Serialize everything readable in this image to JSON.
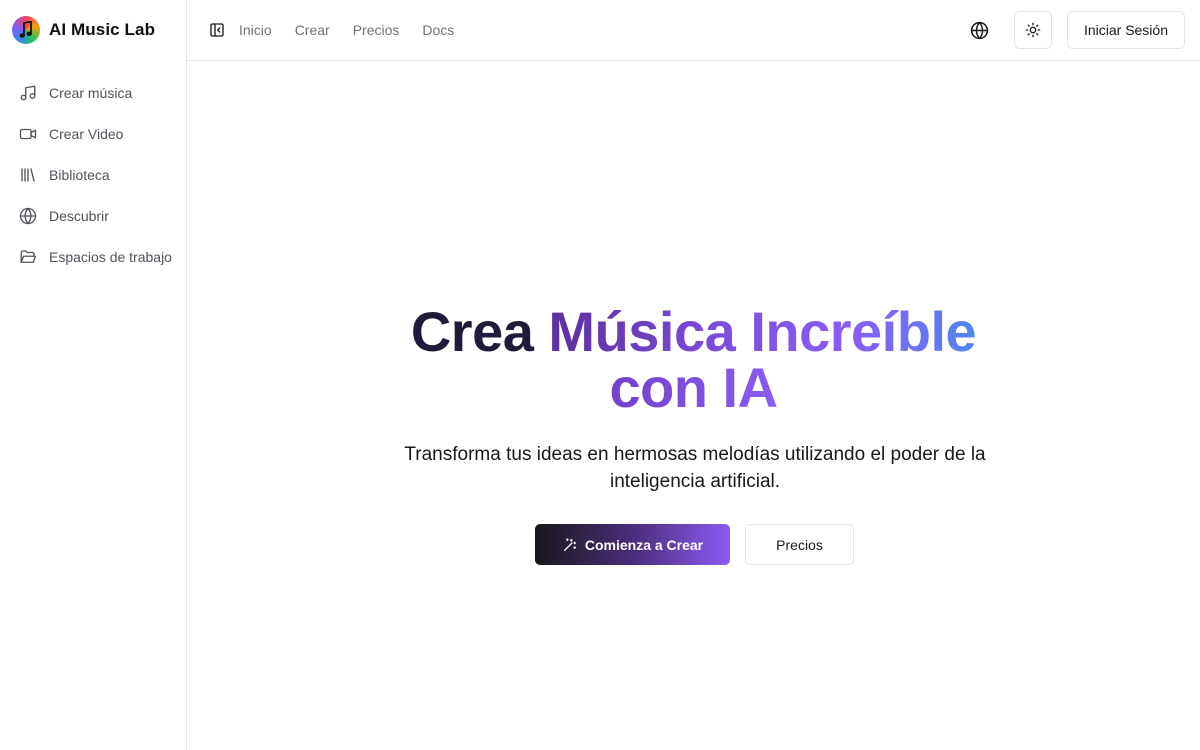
{
  "brand": {
    "name": "AI Music Lab",
    "logo_icon": "music-note-logo-icon"
  },
  "sidebar": {
    "items": [
      {
        "label": "Crear música",
        "icon": "music-note-icon"
      },
      {
        "label": "Crear Video",
        "icon": "video-camera-icon"
      },
      {
        "label": "Biblioteca",
        "icon": "library-icon"
      },
      {
        "label": "Descubrir",
        "icon": "globe-icon"
      },
      {
        "label": "Espacios de trabajo",
        "icon": "folder-open-icon"
      }
    ]
  },
  "topbar": {
    "links": [
      "Inicio",
      "Crear",
      "Precios",
      "Docs"
    ],
    "signin_label": "Iniciar Sesión"
  },
  "hero": {
    "title_plain": "Crea ",
    "title_gradient_1": "Música Increíble",
    "title_gradient_2": "con IA",
    "subtitle": "Transforma tus ideas en hermosas melodías utilizando el poder de la inteligencia artificial.",
    "primary_cta": "Comienza a Crear",
    "secondary_cta": "Precios"
  },
  "colors": {
    "accent": "#8b5cf6",
    "accent_blue": "#4f86ef",
    "border": "#e5e7eb",
    "muted_text": "#71717a"
  }
}
